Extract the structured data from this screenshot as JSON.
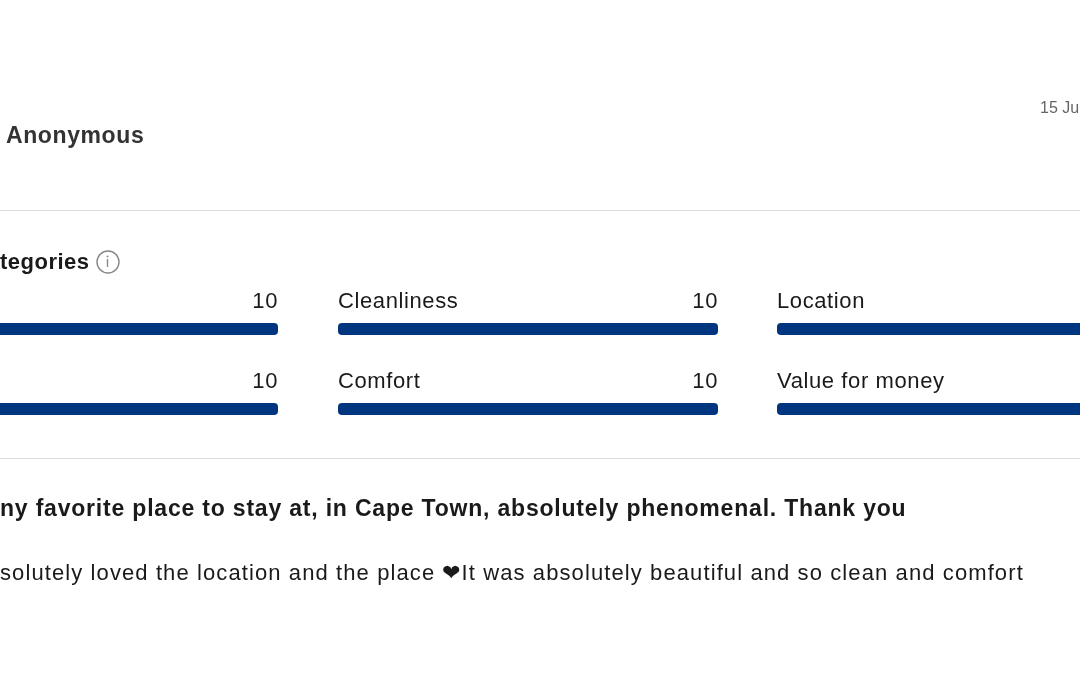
{
  "review": {
    "author": "Anonymous",
    "date": "15 Ju"
  },
  "categories": {
    "heading": "tegories",
    "items": [
      {
        "score": "10",
        "level": 1
      },
      {
        "name": "Cleanliness",
        "score": "10",
        "level": 1
      },
      {
        "name": "Location",
        "level": 1
      },
      {
        "score": "10",
        "level": 1
      },
      {
        "name": "Comfort",
        "score": "10",
        "level": 1
      },
      {
        "name": "Value for money",
        "level": 1
      }
    ]
  },
  "comment": {
    "title": "ny favorite place to stay at, in Cape Town, absolutely phenomenal. Thank you",
    "body": "solutely loved the location and the place ❤It was absolutely beautiful and so clean and comfort"
  }
}
